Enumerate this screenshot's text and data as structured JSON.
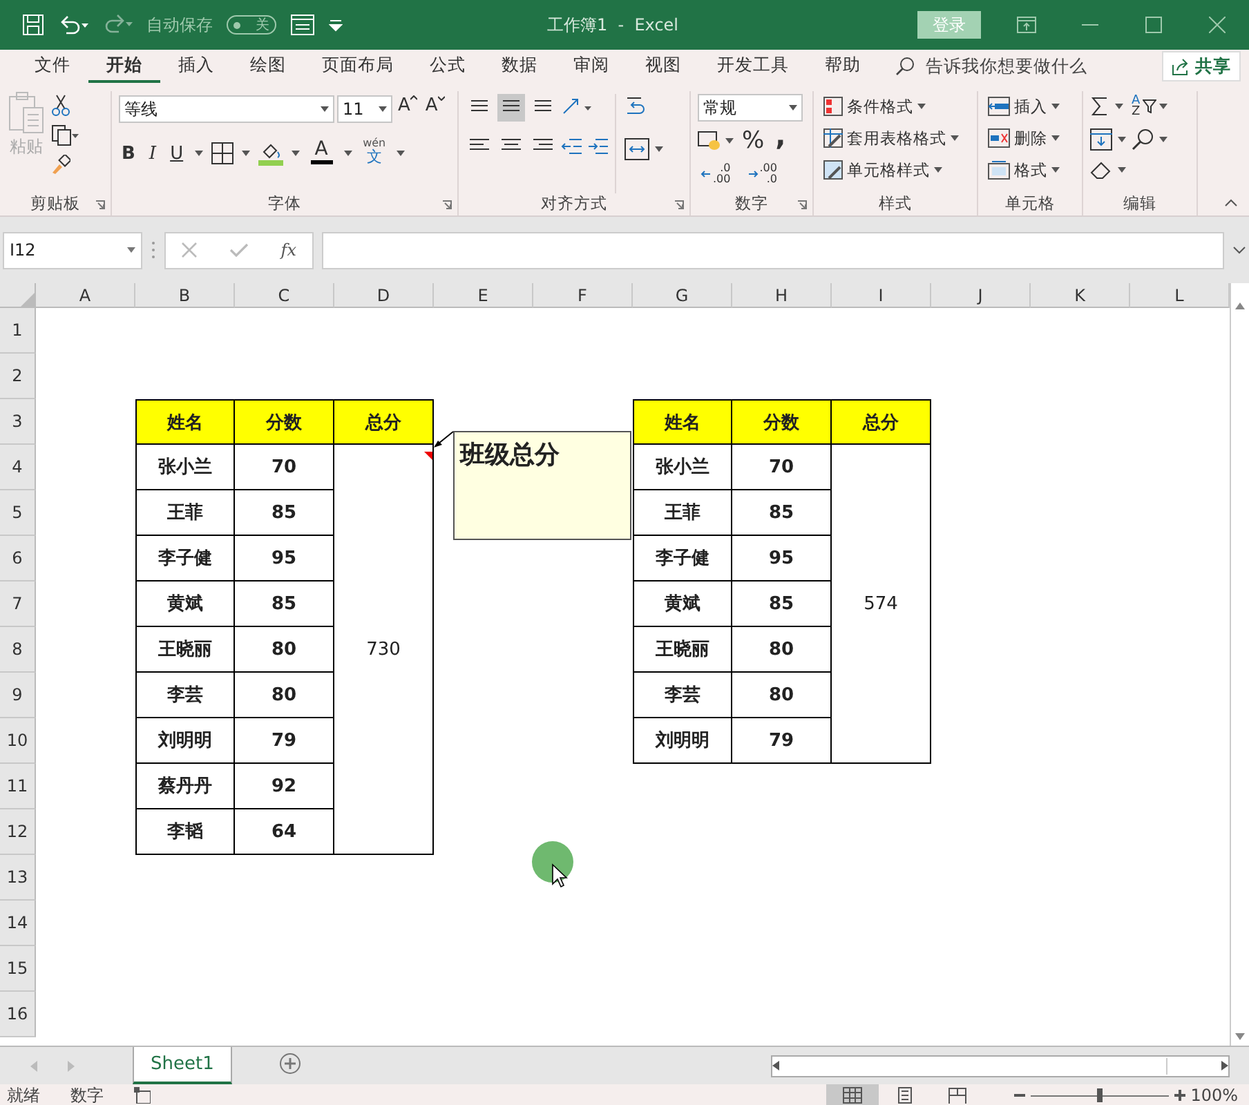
{
  "title_bar": {
    "autosave": {
      "label": "自动保存",
      "state_text": "关",
      "on": false
    },
    "title": "工作簿1  -  Excel",
    "login": "登录"
  },
  "ribbon_tabs": [
    {
      "label": "文件",
      "selected": false
    },
    {
      "label": "开始",
      "selected": true
    },
    {
      "label": "插入",
      "selected": false
    },
    {
      "label": "绘图",
      "selected": false
    },
    {
      "label": "页面布局",
      "selected": false
    },
    {
      "label": "公式",
      "selected": false
    },
    {
      "label": "数据",
      "selected": false
    },
    {
      "label": "审阅",
      "selected": false
    },
    {
      "label": "视图",
      "selected": false
    },
    {
      "label": "开发工具",
      "selected": false
    },
    {
      "label": "帮助",
      "selected": false
    }
  ],
  "tell_me": "告诉我你想要做什么",
  "share": "共享",
  "clipboard": {
    "paste": "粘贴",
    "label": "剪贴板"
  },
  "font": {
    "name": "等线",
    "size": "11",
    "grow": "A",
    "shrink": "A",
    "bold": "B",
    "italic": "I",
    "underline": "U",
    "font_color": "A",
    "phonetic": [
      "wén",
      "文"
    ],
    "label": "字体"
  },
  "alignment": {
    "label": "对齐方式"
  },
  "number": {
    "format": "常规",
    "percent": "%",
    "comma": ",",
    "increase_decimal": [
      ".0",
      ".00"
    ],
    "decrease_decimal": [
      ".00",
      ".0"
    ],
    "label": "数字"
  },
  "styles": {
    "items": [
      "条件格式",
      "套用表格格式",
      "单元格样式"
    ],
    "label": "样式"
  },
  "cells": {
    "items": [
      "插入",
      "删除",
      "格式"
    ],
    "label": "单元格"
  },
  "editing": {
    "sort_letters": [
      "A",
      "Z"
    ],
    "label": "编辑"
  },
  "formula_bar": {
    "name_box": "I12",
    "fx": "fx"
  },
  "columns": [
    "A",
    "B",
    "C",
    "D",
    "E",
    "F",
    "G",
    "H",
    "I",
    "J",
    "K",
    "L"
  ],
  "rows": [
    "1",
    "2",
    "3",
    "4",
    "5",
    "6",
    "7",
    "8",
    "9",
    "10",
    "11",
    "12",
    "13",
    "14",
    "15",
    "16"
  ],
  "tables": [
    {
      "columns": [
        "姓名",
        "分数",
        "总分"
      ],
      "total": "730",
      "rows": [
        {
          "name": "张小兰",
          "score": "70"
        },
        {
          "name": "王菲",
          "score": "85"
        },
        {
          "name": "李子健",
          "score": "95"
        },
        {
          "name": "黄斌",
          "score": "85"
        },
        {
          "name": "王晓丽",
          "score": "80"
        },
        {
          "name": "李芸",
          "score": "80"
        },
        {
          "name": "刘明明",
          "score": "79"
        },
        {
          "name": "蔡丹丹",
          "score": "92"
        },
        {
          "name": "李韬",
          "score": "64"
        }
      ]
    },
    {
      "columns": [
        "姓名",
        "分数",
        "总分"
      ],
      "total": "574",
      "rows": [
        {
          "name": "张小兰",
          "score": "70"
        },
        {
          "name": "王菲",
          "score": "85"
        },
        {
          "name": "李子健",
          "score": "95"
        },
        {
          "name": "黄斌",
          "score": "85"
        },
        {
          "name": "王晓丽",
          "score": "80"
        },
        {
          "name": "李芸",
          "score": "80"
        },
        {
          "name": "刘明明",
          "score": "79"
        }
      ]
    }
  ],
  "comment": {
    "text": "班级总分"
  },
  "sheet_tabs": [
    {
      "label": "Sheet1",
      "selected": true
    }
  ],
  "status_bar": {
    "ready": "就绪",
    "mode": "数字",
    "views": [
      {
        "kind": "normal",
        "selected": true
      },
      {
        "kind": "page_layout",
        "selected": false
      },
      {
        "kind": "page_break",
        "selected": false
      }
    ],
    "zoom": {
      "level": 0.5,
      "reading": "100%"
    }
  }
}
